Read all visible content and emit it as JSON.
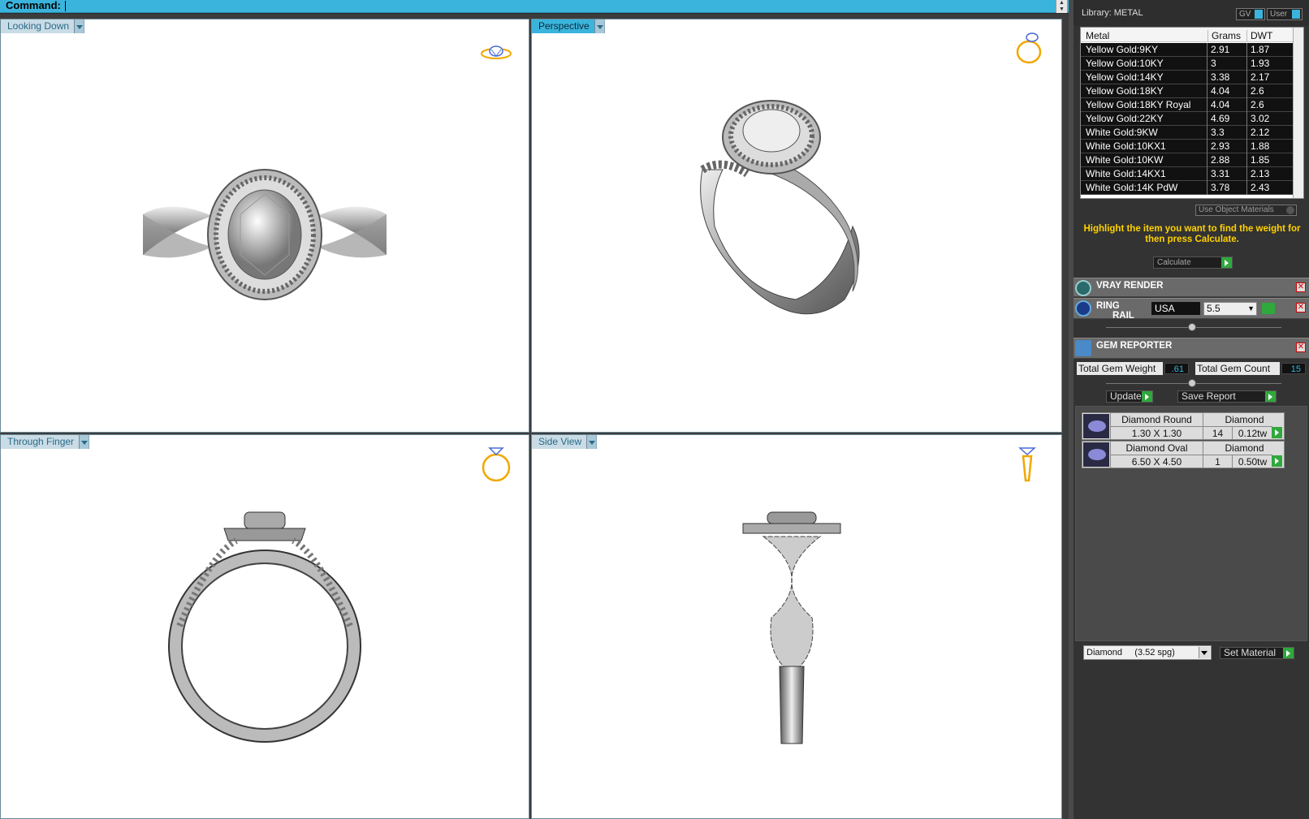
{
  "command": {
    "label": "Command:"
  },
  "viewports": [
    {
      "title": "Looking Down"
    },
    {
      "title": "Perspective"
    },
    {
      "title": "Through Finger"
    },
    {
      "title": "Side View"
    }
  ],
  "library": {
    "title": "Library: METAL",
    "gv_label": "GV",
    "user_label": "User",
    "columns": [
      "Metal",
      "Grams",
      "DWT"
    ],
    "rows": [
      {
        "metal": "Yellow Gold:9KY",
        "grams": "2.91",
        "dwt": "1.87"
      },
      {
        "metal": "Yellow Gold:10KY",
        "grams": "3",
        "dwt": "1.93"
      },
      {
        "metal": "Yellow Gold:14KY",
        "grams": "3.38",
        "dwt": "2.17"
      },
      {
        "metal": "Yellow Gold:18KY",
        "grams": "4.04",
        "dwt": "2.6"
      },
      {
        "metal": "Yellow Gold:18KY Royal",
        "grams": "4.04",
        "dwt": "2.6"
      },
      {
        "metal": "Yellow Gold:22KY",
        "grams": "4.69",
        "dwt": "3.02"
      },
      {
        "metal": "White Gold:9KW",
        "grams": "3.3",
        "dwt": "2.12"
      },
      {
        "metal": "White Gold:10KX1",
        "grams": "2.93",
        "dwt": "1.88"
      },
      {
        "metal": "White Gold:10KW",
        "grams": "2.88",
        "dwt": "1.85"
      },
      {
        "metal": "White Gold:14KX1",
        "grams": "3.31",
        "dwt": "2.13"
      },
      {
        "metal": "White Gold:14K PdW",
        "grams": "3.78",
        "dwt": "2.43"
      }
    ],
    "use_object_materials": "Use Object Materials",
    "hint": "Highlight the item you want to find the weight for then press Calculate.",
    "calculate": "Calculate"
  },
  "vray": {
    "title": "VRAY RENDER"
  },
  "ringrail": {
    "title1": "RING",
    "title2": "RAIL",
    "region": "USA",
    "size": "5.5"
  },
  "gem_reporter": {
    "title": "GEM REPORTER",
    "total_weight_label": "Total Gem Weight",
    "total_weight": ".61",
    "total_count_label": "Total Gem Count",
    "total_count": "15",
    "update": "Update",
    "save_report": "Save Report",
    "gems": [
      {
        "shape": "Diamond Round",
        "size": "1.30 X 1.30",
        "material": "Diamond",
        "count": "14",
        "weight": "0.12tw"
      },
      {
        "shape": "Diamond Oval",
        "size": "6.50 X 4.50",
        "material": "Diamond",
        "count": "1",
        "weight": "0.50tw"
      }
    ],
    "material_select": "Diamond     (3.52 spg)",
    "set_material": "Set Material"
  },
  "colors": {
    "accent": "#3ab4dc",
    "go": "#2fa83c",
    "hint": "#ffd200"
  },
  "icons": [
    "ring-top-icon",
    "ring-perspective-icon",
    "ring-front-icon",
    "ring-side-icon",
    "vray-icon",
    "ringrail-icon",
    "gem-reporter-icon"
  ]
}
